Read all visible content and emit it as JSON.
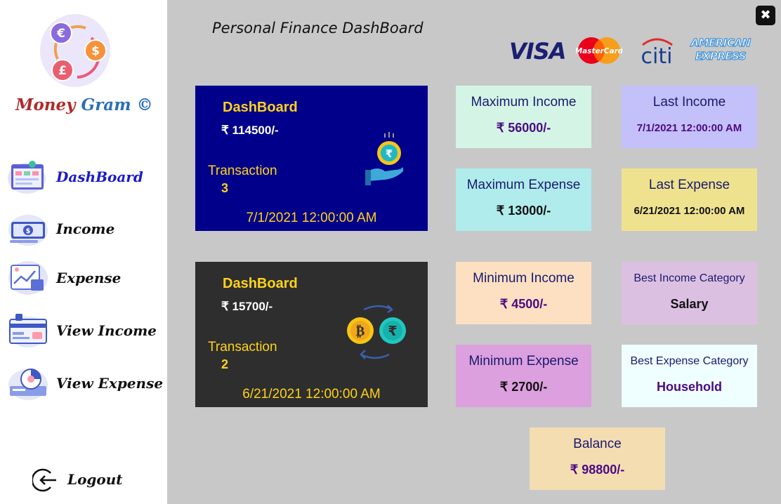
{
  "app": {
    "brand": {
      "part1": "Money",
      "part2": "Gram",
      "part3": "©"
    },
    "title": "Personal Finance DashBoard",
    "close_label": "✖"
  },
  "sidebar": {
    "items": [
      {
        "label": "DashBoard",
        "icon": "dashboard-icon",
        "active": true
      },
      {
        "label": "Income",
        "icon": "money-bill-icon"
      },
      {
        "label": "Expense",
        "icon": "expense-chart-icon"
      },
      {
        "label": "View Income",
        "icon": "credit-card-icon"
      },
      {
        "label": "View Expense",
        "icon": "report-icon"
      }
    ],
    "logout": "Logout"
  },
  "card_brands": {
    "visa": "VISA",
    "mastercard": "MasterCard",
    "citi": "citi",
    "amex_line1": "AMERICAN",
    "amex_line2": "EXPRESS"
  },
  "income_card": {
    "title": "DashBoard",
    "amount": "₹ 114500/-",
    "transaction_label": "Transaction",
    "transaction_count": "3",
    "date": "7/1/2021 12:00:00 AM",
    "color": "#00008b"
  },
  "expense_card": {
    "title": "DashBoard",
    "amount": "₹ 15700/-",
    "transaction_label": "Transaction",
    "transaction_count": "2",
    "date": "6/21/2021 12:00:00 AM",
    "color": "#2e2e2e"
  },
  "stats": {
    "max_income": {
      "label": "Maximum Income",
      "value": "₹ 56000/-",
      "color": "#d4f5e6"
    },
    "last_income": {
      "label": "Last Income",
      "value": "7/1/2021 12:00:00 AM",
      "color": "#c4c0fa"
    },
    "max_expense": {
      "label": "Maximum Expense",
      "value": "₹ 13000/-",
      "color": "#b0ecec"
    },
    "last_expense": {
      "label": "Last Expense",
      "value": "6/21/2021 12:00:00 AM",
      "color": "#eee28e"
    },
    "min_income": {
      "label": "Minimum Income",
      "value": "₹ 4500/-",
      "color": "#fde0c2"
    },
    "best_income_category": {
      "label": "Best Income Category",
      "value": "Salary",
      "color": "#dcc0e2"
    },
    "min_expense": {
      "label": "Minimum Expense",
      "value": "₹ 2700/-",
      "color": "#dca0de"
    },
    "best_expense_category": {
      "label": "Best Expense Category",
      "value": "Household",
      "color": "#effefe"
    },
    "balance": {
      "label": "Balance",
      "value": "₹ 98800/-",
      "color": "#f5ddb2"
    }
  }
}
